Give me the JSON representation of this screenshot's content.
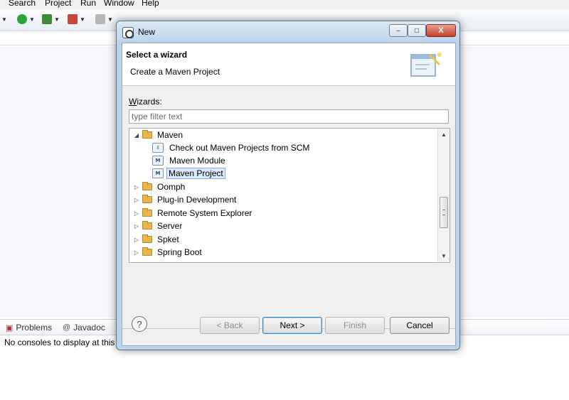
{
  "menubar": {
    "items": [
      "Search",
      "Project",
      "Run",
      "Window",
      "Help"
    ]
  },
  "bottom_panel": {
    "tabs": [
      {
        "label": "Problems",
        "icon": "problems-icon"
      },
      {
        "label": "Javadoc",
        "icon": "at-icon"
      }
    ],
    "console_message": "No consoles to display at this"
  },
  "dialog": {
    "title": "New",
    "window_buttons": {
      "minimize": "–",
      "maximize": "□",
      "close": "X"
    },
    "header": {
      "title": "Select a wizard",
      "description": "Create a Maven Project"
    },
    "wizards_label": {
      "underlined": "W",
      "rest": "izards:"
    },
    "filter": {
      "value": "",
      "placeholder": "type filter text"
    },
    "tree": [
      {
        "label": "Maven",
        "type": "folder",
        "expanded": true
      },
      {
        "label": "Check out Maven Projects from SCM",
        "type": "maven",
        "icon": "checkout-icon"
      },
      {
        "label": "Maven Module",
        "type": "maven",
        "icon": "maven-module-icon"
      },
      {
        "label": "Maven Project",
        "type": "maven",
        "icon": "maven-project-icon",
        "selected": true
      },
      {
        "label": "Oomph",
        "type": "folder",
        "expanded": false
      },
      {
        "label": "Plug-in Development",
        "type": "folder",
        "expanded": false
      },
      {
        "label": "Remote System Explorer",
        "type": "folder",
        "expanded": false
      },
      {
        "label": "Server",
        "type": "folder",
        "expanded": false
      },
      {
        "label": "Spket",
        "type": "folder",
        "expanded": false
      },
      {
        "label": "Spring Boot",
        "type": "folder",
        "expanded": false
      }
    ],
    "buttons": {
      "help": "?",
      "back": "< Back",
      "next": "Next >",
      "finish": "Finish",
      "cancel": "Cancel"
    }
  },
  "colors": {
    "selection": "#d9e8fb",
    "dialog_frame": "#bcd3ec",
    "folder": "#e9b64e"
  }
}
